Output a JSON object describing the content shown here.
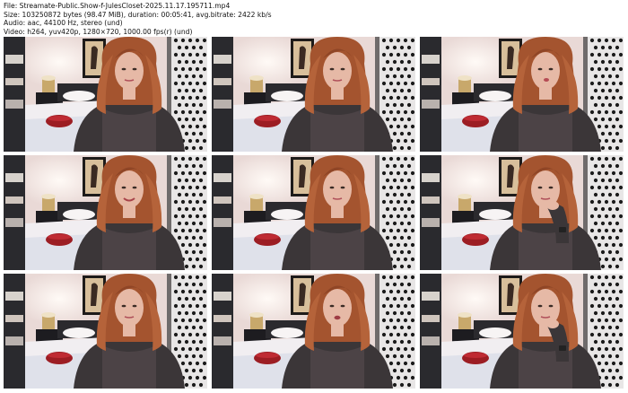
{
  "header": {
    "line1": "File: Streamate-Public.Show-f-JulesCloset-2025.11.17.195711.mp4",
    "line2": "Size: 103250872 bytes (98.47 MiB), duration: 00:05:41, avg.bitrate: 2422 kb/s",
    "line3": "Audio: aac, 44100 Hz, stereo (und)",
    "line4": "Video: h264, yuv420p, 1280×720, 1000.00 fps(r) (und)"
  },
  "thumbnails": [
    {
      "id": 1,
      "pose": "neutral"
    },
    {
      "id": 2,
      "pose": "neutral"
    },
    {
      "id": 3,
      "pose": "lips"
    },
    {
      "id": 4,
      "pose": "smile"
    },
    {
      "id": 5,
      "pose": "neutral"
    },
    {
      "id": 6,
      "pose": "hand-chin"
    },
    {
      "id": 7,
      "pose": "neutral"
    },
    {
      "id": 8,
      "pose": "talking"
    },
    {
      "id": 9,
      "pose": "hand-chin"
    }
  ],
  "colors": {
    "wall": "#e9d9d6",
    "bed": "#f1eef1",
    "hair": "#a4542f",
    "top": "#3b3638",
    "skin": "#e6b9a6",
    "pillow_red": "#9c1d23",
    "dots_panel": "#e8e6e6",
    "dark_furniture": "#2a2a2e"
  }
}
